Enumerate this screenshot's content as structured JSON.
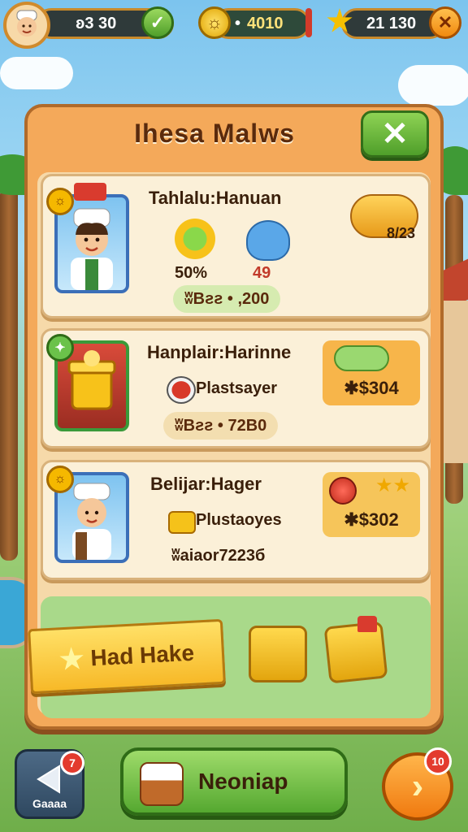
{
  "hud": {
    "player_value": "ʚ3 30",
    "gold_value": "4010",
    "gold_prefix": "•",
    "stars_value": "21 130"
  },
  "panel": {
    "title": "Ihesa Malws"
  },
  "cards": [
    {
      "title": "Tahlalu:Hanuan",
      "stat_left": "50%",
      "stat_right": "49",
      "price": "ʬBƨƨ • ,200",
      "reward": "8/23"
    },
    {
      "title": "Hanplair:Harinne",
      "subtitle": "Plastsayer",
      "price": "ʬBƨƨ • 72B0",
      "reward": "✱$304"
    },
    {
      "title": "Belijar:Hager",
      "subtitle": "Plustaoyes",
      "price": "ʬaiaor7223б",
      "reward": "✱$302"
    }
  ],
  "shop": {
    "banner_label": "Had Hake"
  },
  "nav": {
    "left_label": "Gaaaa",
    "left_badge": "7",
    "main_label": "Neoniap",
    "right_badge": "10"
  },
  "colors": {
    "panel_bg": "#f4a95a",
    "card_bg": "#fbf0d8",
    "accent_green": "#55a830",
    "accent_orange": "#f07a10"
  }
}
